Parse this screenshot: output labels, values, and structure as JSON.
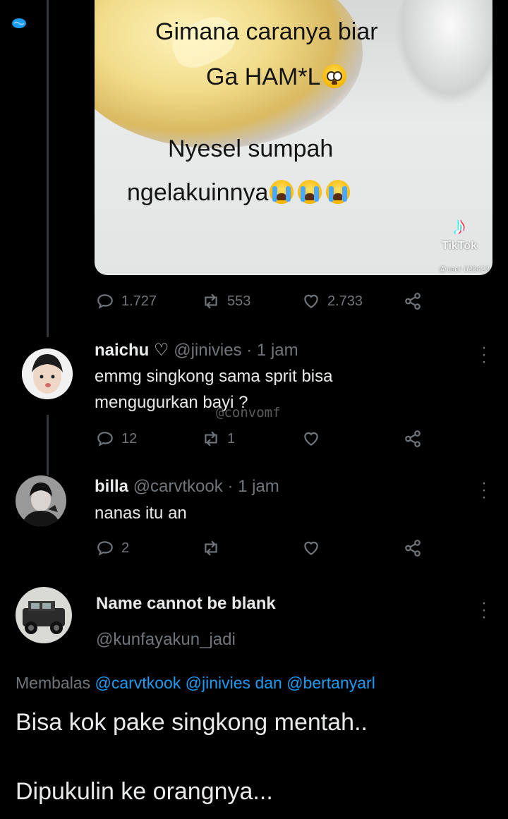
{
  "media": {
    "caption_line1": "Gimana caranya biar",
    "caption_line2": "Ga HAM*L",
    "caption_line3": "Nyesel sumpah",
    "caption_line4": "ngelakuinnya",
    "emoji_pleading": "pleading-face-emoji",
    "emoji_crying": "loudly-crying-face-emoji",
    "tiktok_brand": "TikTok",
    "tiktok_user": "@user 020423"
  },
  "main_actions": {
    "replies": "1.727",
    "retweets": "553",
    "likes": "2.733"
  },
  "replies": [
    {
      "name": "naichu",
      "heart": "♡",
      "handle": "@jinivies",
      "time": "· 1 jam",
      "text_line1": "emmg singkong sama sprit bisa",
      "text_line2": "mengugurkan bayi ?",
      "replies": "12",
      "retweets": "1",
      "likes": ""
    },
    {
      "name": "billa",
      "handle": "@carvtkook",
      "time": "· 1 jam",
      "text_line1": "nanas itu an",
      "replies": "2",
      "retweets": "",
      "likes": ""
    }
  ],
  "watermark": "@convomf",
  "main_tweet": {
    "name": "Name cannot be blank",
    "handle": "@kunfayakun_jadi",
    "replying_prefix": "Membalas",
    "replying_to_1": "@carvtkook",
    "replying_to_2": "@jinivies",
    "replying_and": "dan",
    "replying_to_3": "@bertanyarl",
    "text_line1": "Bisa kok pake singkong mentah..",
    "text_line2": "Dipukulin ke orangnya..."
  },
  "colors": {
    "background": "#000000",
    "text": "#e7e9ea",
    "muted": "#71767b",
    "link": "#1d9bf0",
    "divider": "#333639"
  }
}
